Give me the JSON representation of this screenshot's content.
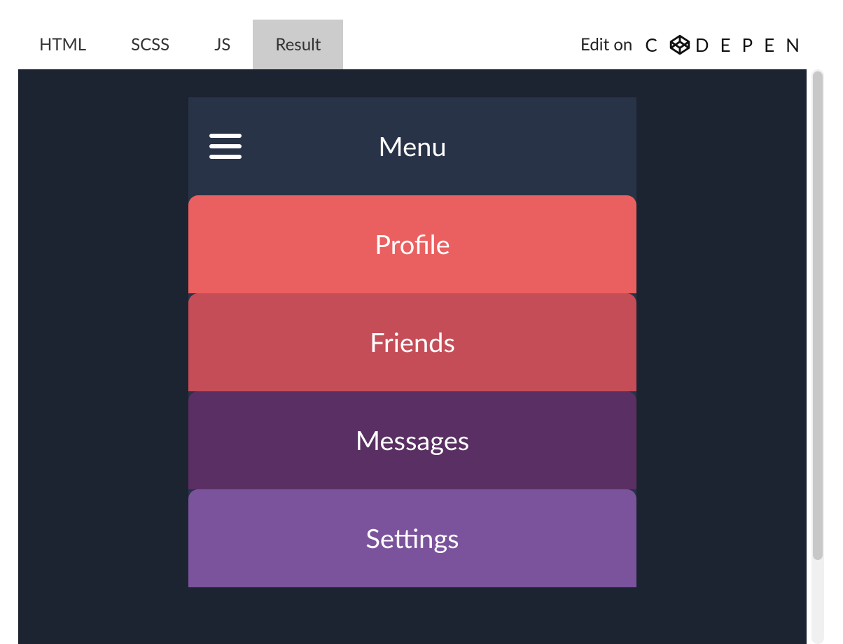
{
  "topbar": {
    "tabs": [
      {
        "label": "HTML",
        "active": false
      },
      {
        "label": "SCSS",
        "active": false
      },
      {
        "label": "JS",
        "active": false
      },
      {
        "label": "Result",
        "active": true
      }
    ],
    "edit_on": "Edit on",
    "brand": "CODEPEN"
  },
  "menu": {
    "title": "Menu",
    "items": [
      {
        "label": "Profile",
        "color": "#ea6060"
      },
      {
        "label": "Friends",
        "color": "#c54d57"
      },
      {
        "label": "Messages",
        "color": "#5a2f63"
      },
      {
        "label": "Settings",
        "color": "#7b539c"
      }
    ]
  }
}
